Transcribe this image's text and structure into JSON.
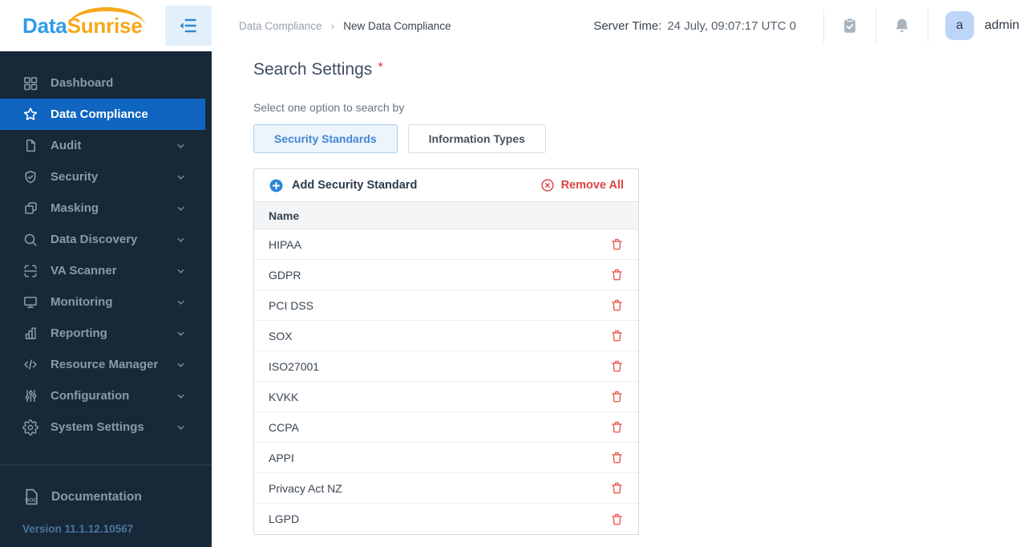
{
  "header": {
    "logo_part1": "Data",
    "logo_part2": "Sunrise",
    "breadcrumb": {
      "parent": "Data Compliance",
      "separator": "›",
      "current": "New Data Compliance"
    },
    "server_time_label": "Server Time:",
    "server_time_value": "24 July, 09:07:17  UTC 0",
    "user_initial": "a",
    "user_name": "admin"
  },
  "sidebar": {
    "items": [
      {
        "label": "Dashboard",
        "icon": "grid-icon",
        "active": false,
        "expandable": false
      },
      {
        "label": "Data Compliance",
        "icon": "star-icon",
        "active": true,
        "expandable": false
      },
      {
        "label": "Audit",
        "icon": "document-icon",
        "active": false,
        "expandable": true
      },
      {
        "label": "Security",
        "icon": "shield-check-icon",
        "active": false,
        "expandable": true
      },
      {
        "label": "Masking",
        "icon": "mask-icon",
        "active": false,
        "expandable": true
      },
      {
        "label": "Data Discovery",
        "icon": "magnifier-icon",
        "active": false,
        "expandable": true
      },
      {
        "label": "VA Scanner",
        "icon": "scanner-icon",
        "active": false,
        "expandable": true
      },
      {
        "label": "Monitoring",
        "icon": "monitor-icon",
        "active": false,
        "expandable": true
      },
      {
        "label": "Reporting",
        "icon": "bar-chart-icon",
        "active": false,
        "expandable": true
      },
      {
        "label": "Resource Manager",
        "icon": "code-icon",
        "active": false,
        "expandable": true
      },
      {
        "label": "Configuration",
        "icon": "sliders-icon",
        "active": false,
        "expandable": true
      },
      {
        "label": "System Settings",
        "icon": "gear-icon",
        "active": false,
        "expandable": true
      }
    ],
    "documentation_label": "Documentation",
    "doc_icon_text": "DOC",
    "version": "Version 11.1.12.10567"
  },
  "main": {
    "title": "Search Settings",
    "required_marker": "*",
    "subtitle": "Select one option to search by",
    "tabs": [
      {
        "label": "Security Standards",
        "selected": true
      },
      {
        "label": "Information Types",
        "selected": false
      }
    ],
    "panel": {
      "add_label": "Add Security Standard",
      "remove_all_label": "Remove All",
      "column_header": "Name",
      "rows": [
        "HIPAA",
        "GDPR",
        "PCI DSS",
        "SOX",
        "ISO27001",
        "KVKK",
        "CCPA",
        "APPI",
        "Privacy Act NZ",
        "LGPD"
      ]
    }
  },
  "colors": {
    "sidebar_bg": "#172838",
    "active_item_bg": "#0f65c0",
    "logo_blue": "#2f9ce8",
    "logo_orange": "#f7a81b",
    "accent_blue": "#2b86d7",
    "danger_red": "#dd4545",
    "trash_red": "#ea5a51",
    "selected_tab_bg": "#ecf4fc",
    "selected_tab_border": "#a9cdf0",
    "selected_tab_text": "#4187d4",
    "header_icon_gray": "#a9b4bd",
    "avatar_bg": "#bdd6f8"
  }
}
